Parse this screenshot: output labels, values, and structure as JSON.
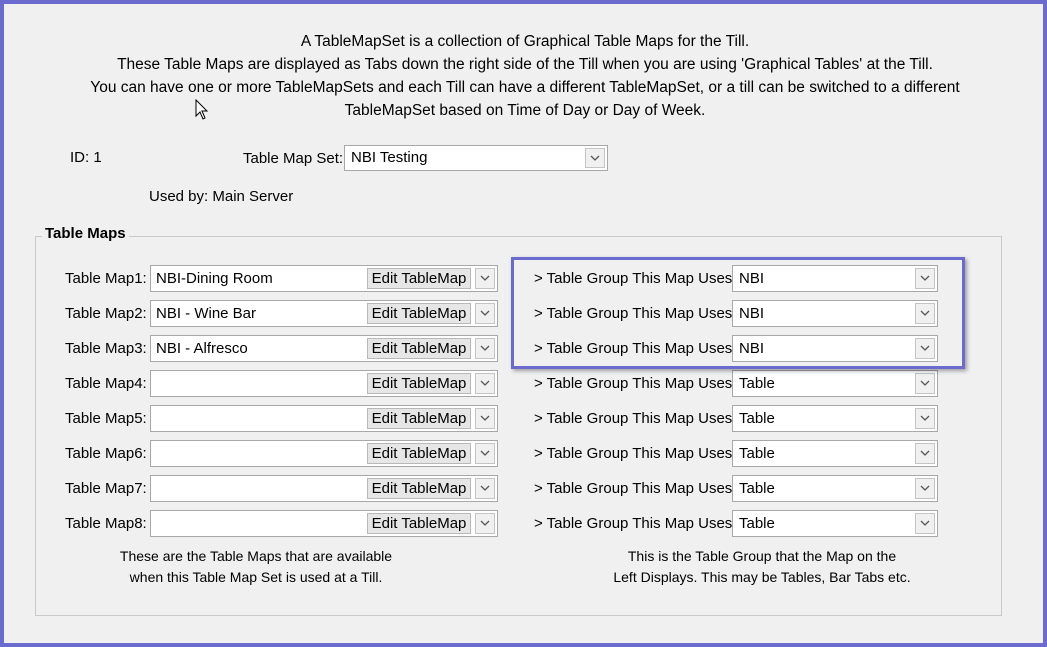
{
  "intro": {
    "line1": "A TableMapSet is a collection of Graphical Table Maps for the Till.",
    "line2": "These Table Maps are displayed as Tabs down the right side of the Till when you are using 'Graphical Tables' at the Till.",
    "line3": "You can have one or more TableMapSets and each Till can have a different TableMapSet, or a till can be switched to a different",
    "line4": "TableMapSet based on Time of Day or Day of Week."
  },
  "header": {
    "id_label": "ID: 1",
    "set_label": "Table Map Set:",
    "set_value": "NBI Testing",
    "used_by": "Used by: Main Server"
  },
  "group_title": "Table Maps",
  "edit_label": "Edit TableMap",
  "maps": [
    {
      "label": "Table Map1:",
      "value": "NBI-Dining Room",
      "tg_label": "> Table Group This Map Uses:",
      "tg_value": "NBI"
    },
    {
      "label": "Table Map2:",
      "value": "NBI - Wine Bar",
      "tg_label": "> Table Group This Map Uses:",
      "tg_value": "NBI"
    },
    {
      "label": "Table Map3:",
      "value": "NBI - Alfresco",
      "tg_label": "> Table Group This Map Uses:",
      "tg_value": "NBI"
    },
    {
      "label": "Table Map4:",
      "value": "",
      "tg_label": "> Table Group This Map Uses:",
      "tg_value": "Table"
    },
    {
      "label": "Table Map5:",
      "value": "",
      "tg_label": "> Table Group This Map Uses:",
      "tg_value": "Table"
    },
    {
      "label": "Table Map6:",
      "value": "",
      "tg_label": "> Table Group This Map Uses:",
      "tg_value": "Table"
    },
    {
      "label": "Table Map7:",
      "value": "",
      "tg_label": "> Table Group This Map Uses:",
      "tg_value": "Table"
    },
    {
      "label": "Table Map8:",
      "value": "",
      "tg_label": "> Table Group This Map Uses:",
      "tg_value": "Table"
    }
  ],
  "notes": {
    "left1": "These are the Table Maps that are available",
    "left2": "when this Table Map Set is used at a Till.",
    "right1": "This is the Table Group that the Map on the",
    "right2": "Left Displays. This may be Tables, Bar Tabs etc."
  },
  "colors": {
    "highlight": "#6b6bcf",
    "background": "#f0f0f0"
  },
  "icons": {
    "dropdown": "chevron-down-icon",
    "cursor": "mouse-cursor-icon"
  }
}
